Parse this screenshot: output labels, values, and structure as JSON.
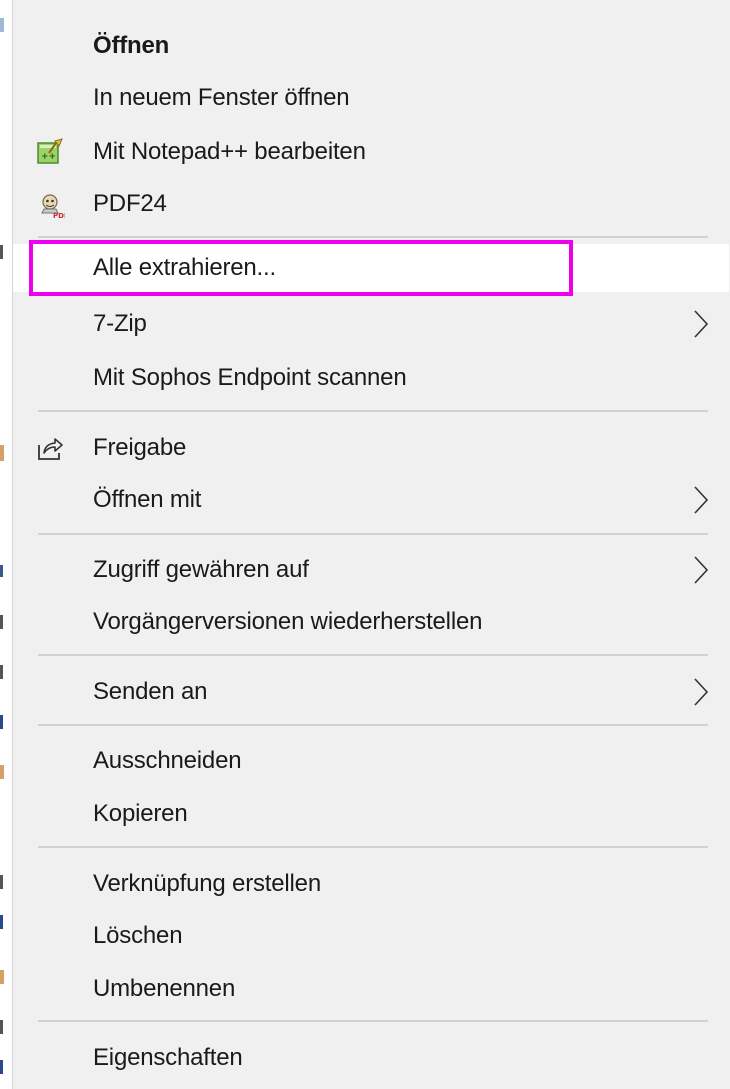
{
  "menu": {
    "items": [
      {
        "label": "Öffnen"
      },
      {
        "label": "In neuem Fenster öffnen"
      },
      {
        "label": "Mit Notepad++ bearbeiten",
        "icon": "notepad-plus-plus-icon"
      },
      {
        "label": "PDF24",
        "icon": "pdf24-icon"
      },
      {
        "label": "Alle extrahieren..."
      },
      {
        "label": "7-Zip",
        "submenu": true
      },
      {
        "label": "Mit Sophos Endpoint scannen"
      },
      {
        "label": "Freigabe",
        "icon": "share-icon"
      },
      {
        "label": "Öffnen mit",
        "submenu": true
      },
      {
        "label": "Zugriff gewähren auf",
        "submenu": true
      },
      {
        "label": "Vorgängerversionen wiederherstellen"
      },
      {
        "label": "Senden an",
        "submenu": true
      },
      {
        "label": "Ausschneiden"
      },
      {
        "label": "Kopieren"
      },
      {
        "label": "Verknüpfung erstellen"
      },
      {
        "label": "Löschen"
      },
      {
        "label": "Umbenennen"
      },
      {
        "label": "Eigenschaften"
      }
    ]
  },
  "colors": {
    "menu_background": "#f0f0f0",
    "highlight_background": "#ffffff",
    "annotation_border": "#ee00ee",
    "separator": "#d2d2d2"
  }
}
